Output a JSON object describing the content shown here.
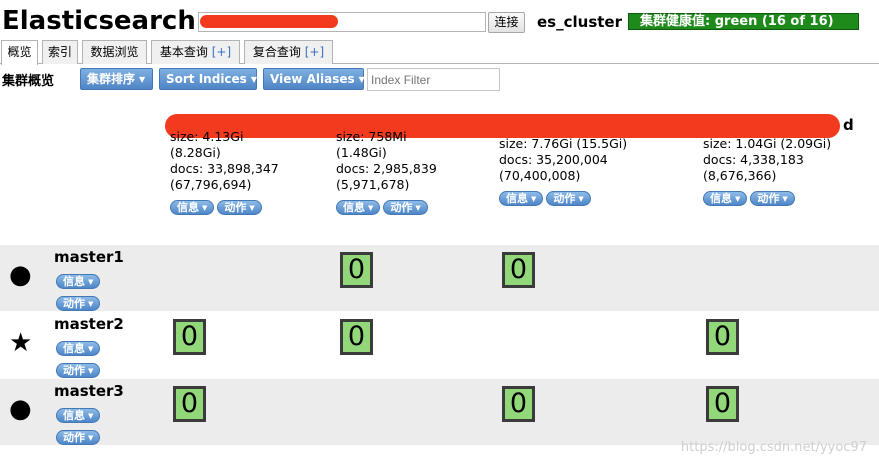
{
  "app_title": "Elasticsearch",
  "connect_label": "连接",
  "cluster_name": "es_cluster",
  "health_text": "集群健康值: green (16 of 16)",
  "health_color": "#1f8a1c",
  "tabs": [
    {
      "label": "概览",
      "plus": ""
    },
    {
      "label": "索引",
      "plus": ""
    },
    {
      "label": "数据浏览",
      "plus": ""
    },
    {
      "label": "基本查询 ",
      "plus": "[+]"
    },
    {
      "label": "复合查询 ",
      "plus": "[+]"
    }
  ],
  "toolbar": {
    "title": "集群概览",
    "sort_cluster": "集群排序",
    "sort_indices": "Sort Indices",
    "view_aliases": "View Aliases",
    "filter_placeholder": "Index Filter"
  },
  "indices": [
    {
      "size": "size: 4.13Gi",
      "size_total": "(8.28Gi)",
      "docs": "docs: 33,898,347",
      "docs_total": "(67,796,694)",
      "info": "信息",
      "action": "动作"
    },
    {
      "size": "size: 758Mi",
      "size_total": "(1.48Gi)",
      "docs": "docs: 2,985,839",
      "docs_total": "(5,971,678)",
      "info": "信息",
      "action": "动作"
    },
    {
      "size": "size: 7.76Gi (15.5Gi)",
      "docs": "docs: 35,200,004",
      "docs_total": "(70,400,008)",
      "info": "信息",
      "action": "动作"
    },
    {
      "size": "size: 1.04Gi (2.09Gi)",
      "docs": "docs: 4,338,183",
      "docs_total": "(8,676,366)",
      "info": "信息",
      "action": "动作"
    }
  ],
  "index_tail_char": "d",
  "nodes": [
    {
      "name": "master1",
      "icon": "circle-icon",
      "glyph": "●",
      "info": "信息",
      "action": "动作",
      "shards": [
        "",
        "0",
        "0",
        ""
      ]
    },
    {
      "name": "master2",
      "icon": "star-icon",
      "glyph": "★",
      "info": "信息",
      "action": "动作",
      "shards": [
        "0",
        "0",
        "",
        "0"
      ]
    },
    {
      "name": "master3",
      "icon": "circle-icon",
      "glyph": "●",
      "info": "信息",
      "action": "动作",
      "shards": [
        "0",
        "",
        "0",
        "0"
      ]
    }
  ],
  "watermark": "https://blog.csdn.net/yyoc97"
}
